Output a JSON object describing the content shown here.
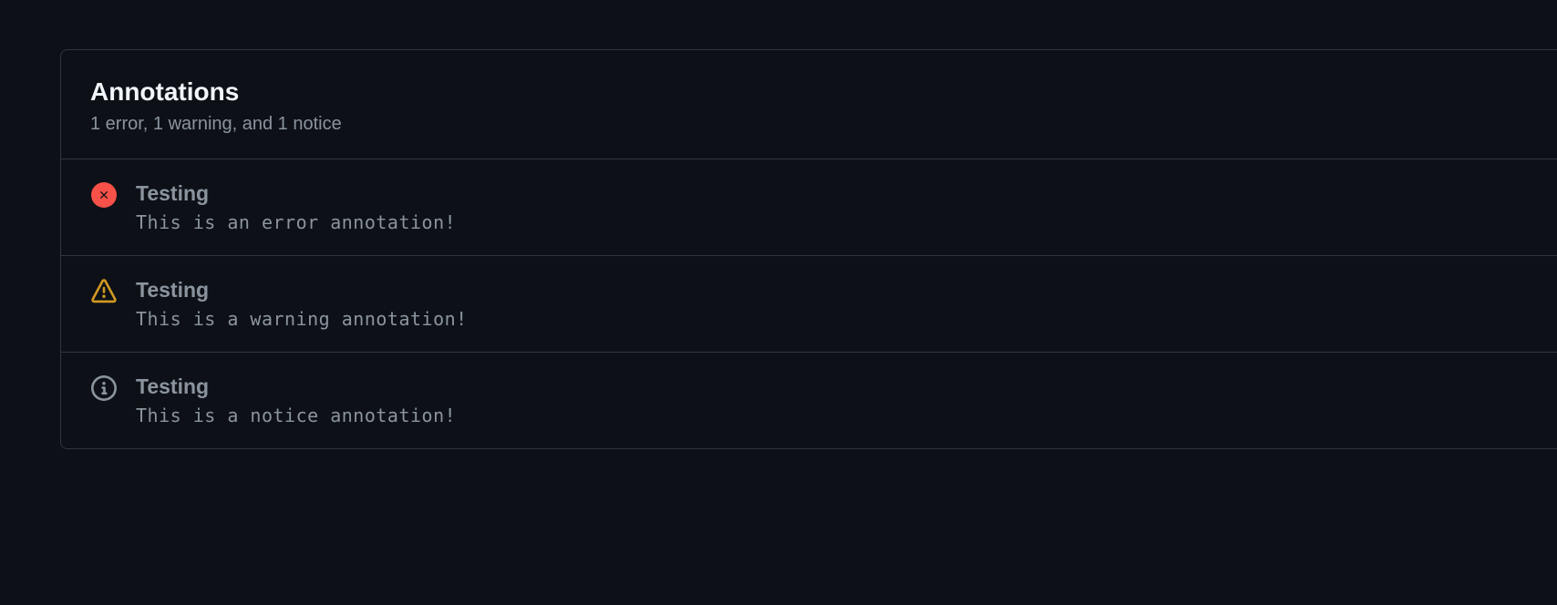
{
  "panel": {
    "title": "Annotations",
    "subtitle": "1 error, 1 warning, and 1 notice"
  },
  "annotations": [
    {
      "type": "error",
      "title": "Testing",
      "message": "This is an error annotation!"
    },
    {
      "type": "warning",
      "title": "Testing",
      "message": "This is a warning annotation!"
    },
    {
      "type": "notice",
      "title": "Testing",
      "message": "This is a notice annotation!"
    }
  ]
}
